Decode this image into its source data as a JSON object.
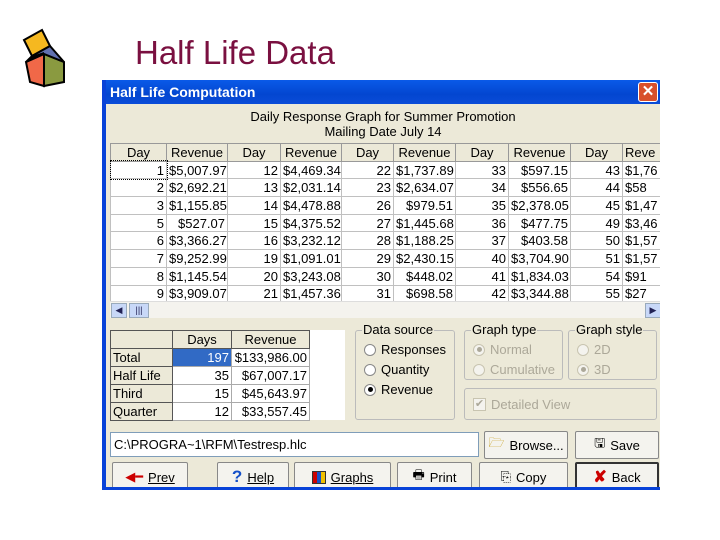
{
  "slide": {
    "title": "Half Life Data"
  },
  "window": {
    "title": "Half Life Computation",
    "close_icon": "close-icon"
  },
  "caption": {
    "line1": "Daily Response Graph for Summer Promotion",
    "line2": "Mailing Date July 14"
  },
  "grid": {
    "headers": [
      "Day",
      "Revenue",
      "Day",
      "Revenue",
      "Day",
      "Revenue",
      "Day",
      "Revenue",
      "Day",
      "Reve"
    ],
    "rows": [
      [
        "1",
        "$5,007.97",
        "12",
        "$4,469.34",
        "22",
        "$1,737.89",
        "33",
        "$597.15",
        "43",
        "$1,76"
      ],
      [
        "2",
        "$2,692.21",
        "13",
        "$2,031.14",
        "23",
        "$2,634.07",
        "34",
        "$556.65",
        "44",
        "$58"
      ],
      [
        "3",
        "$1,155.85",
        "14",
        "$4,478.88",
        "26",
        "$979.51",
        "35",
        "$2,378.05",
        "45",
        "$1,47"
      ],
      [
        "5",
        "$527.07",
        "15",
        "$4,375.52",
        "27",
        "$1,445.68",
        "36",
        "$477.75",
        "49",
        "$3,46"
      ],
      [
        "6",
        "$3,366.27",
        "16",
        "$3,232.12",
        "28",
        "$1,188.25",
        "37",
        "$403.58",
        "50",
        "$1,57"
      ],
      [
        "7",
        "$9,252.99",
        "19",
        "$1,091.01",
        "29",
        "$2,430.15",
        "40",
        "$3,704.90",
        "51",
        "$1,57"
      ],
      [
        "8",
        "$1,145.54",
        "20",
        "$3,243.08",
        "30",
        "$448.02",
        "41",
        "$1,834.03",
        "54",
        "$91"
      ],
      [
        "9",
        "$3,909.07",
        "21",
        "$1,457.36",
        "31",
        "$698.58",
        "42",
        "$3,344.88",
        "55",
        "$27"
      ]
    ]
  },
  "summary": {
    "headers": [
      "Days",
      "Revenue"
    ],
    "rows": [
      {
        "label": "Total",
        "days": "197",
        "revenue": "$133,986.00"
      },
      {
        "label": "Half Life",
        "days": "35",
        "revenue": "$67,007.17"
      },
      {
        "label": "Third",
        "days": "15",
        "revenue": "$45,643.97"
      },
      {
        "label": "Quarter",
        "days": "12",
        "revenue": "$33,557.45"
      }
    ]
  },
  "data_source": {
    "label": "Data source",
    "options": [
      "Responses",
      "Quantity",
      "Revenue"
    ],
    "selected": "Revenue"
  },
  "graph_type": {
    "label": "Graph type",
    "options": [
      "Normal",
      "Cumulative"
    ],
    "selected": "Normal",
    "enabled": false
  },
  "graph_style": {
    "label": "Graph style",
    "options": [
      "2D",
      "3D"
    ],
    "selected": "3D",
    "enabled": false
  },
  "detailed_view": {
    "label": "Detailed View",
    "checked": true,
    "enabled": false
  },
  "file": {
    "path": "C:\\PROGRA~1\\RFM\\Testresp.hlc"
  },
  "buttons": {
    "browse": "Browse...",
    "save": "Save",
    "prev": "Prev",
    "help": "Help",
    "graphs": "Graphs",
    "print": "Print",
    "copy": "Copy",
    "back": "Back"
  }
}
